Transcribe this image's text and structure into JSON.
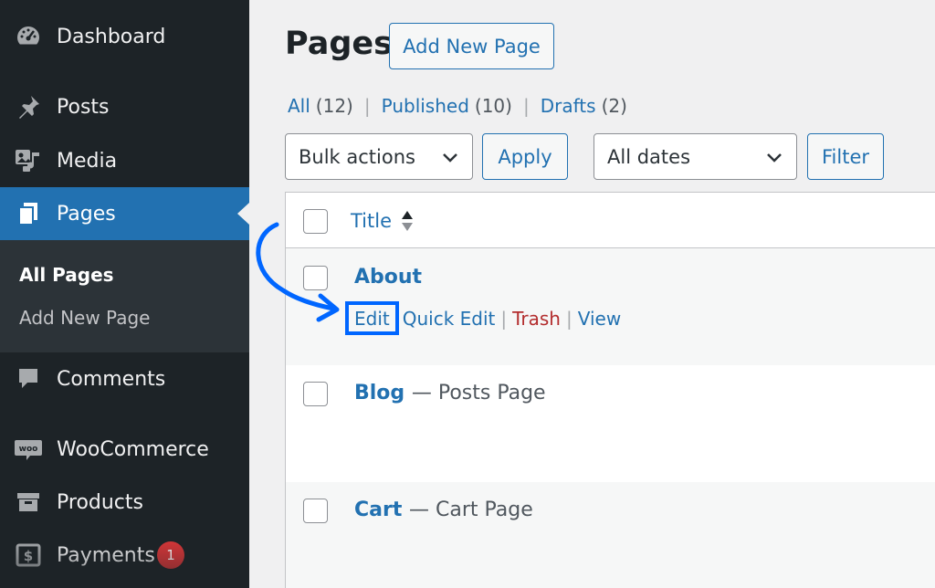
{
  "sidebar": {
    "items": [
      {
        "label": "Dashboard",
        "icon": "dashboard-icon"
      },
      {
        "label": "Posts",
        "icon": "pin-icon"
      },
      {
        "label": "Media",
        "icon": "media-icon"
      },
      {
        "label": "Pages",
        "icon": "pages-icon",
        "active": true
      },
      {
        "label": "Comments",
        "icon": "comment-icon"
      },
      {
        "label": "WooCommerce",
        "icon": "woocommerce-icon"
      },
      {
        "label": "Products",
        "icon": "archive-icon"
      },
      {
        "label": "Payments",
        "icon": "dollar-icon",
        "badge": "1"
      }
    ],
    "submenu": [
      {
        "label": "All Pages",
        "current": true
      },
      {
        "label": "Add New Page"
      }
    ]
  },
  "header": {
    "title": "Pages",
    "add_new": "Add New Page"
  },
  "filters": {
    "all": {
      "label": "All",
      "count": "(12)"
    },
    "published": {
      "label": "Published",
      "count": "(10)"
    },
    "drafts": {
      "label": "Drafts",
      "count": "(2)"
    },
    "separator": "|"
  },
  "toolbar": {
    "bulk_actions": "Bulk actions",
    "apply": "Apply",
    "dates": "All dates",
    "filter": "Filter"
  },
  "table": {
    "column_title": "Title",
    "rows": [
      {
        "title": "About",
        "state": "",
        "actions": {
          "edit": "Edit",
          "quick_edit": "Quick Edit",
          "trash": "Trash",
          "view": "View"
        }
      },
      {
        "title": "Blog",
        "state": "— Posts Page"
      },
      {
        "title": "Cart",
        "state": "— Cart Page"
      }
    ]
  },
  "colors": {
    "sidebar_bg": "#1d2327",
    "accent": "#2271b1",
    "trash": "#b32d2e",
    "highlight": "#0066ff",
    "badge": "#d63638"
  }
}
